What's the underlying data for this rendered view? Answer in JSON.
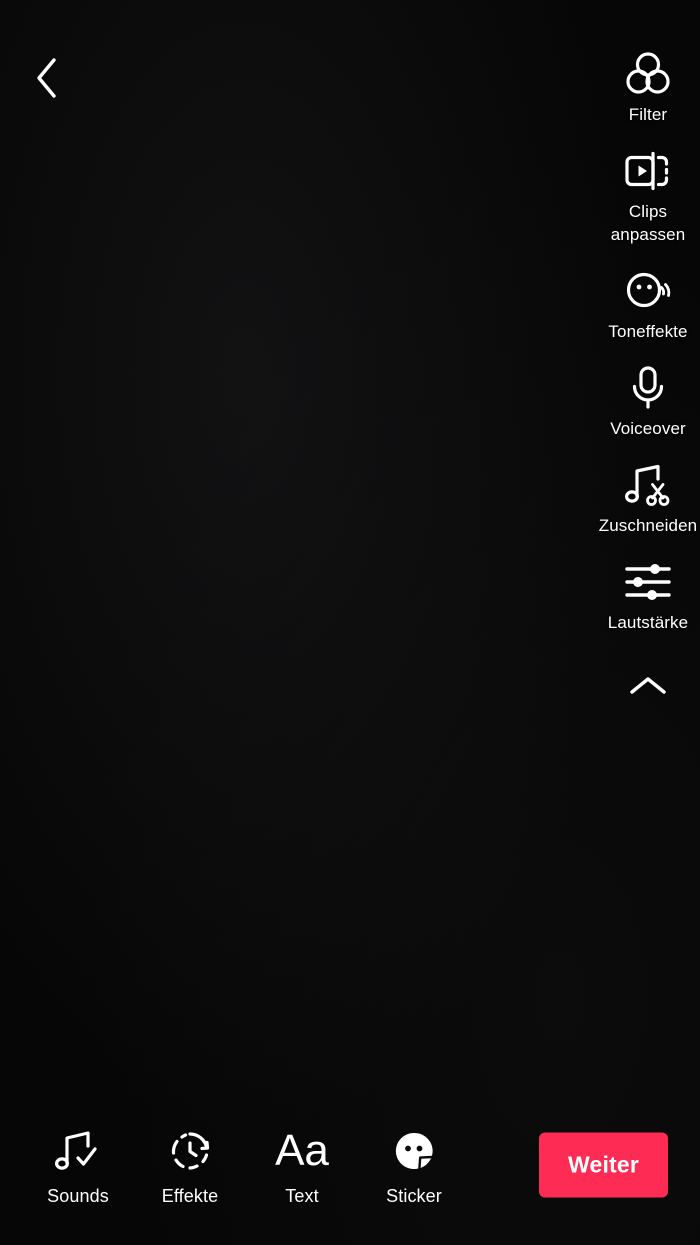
{
  "app": {
    "screen_name": "TikTok Video Editor",
    "background_color": "#000000",
    "accent_color": "#FE2C55"
  },
  "header": {
    "back_icon": "chevron-left-icon"
  },
  "tool_rail": {
    "collapse_icon": "chevron-up-icon",
    "items": [
      {
        "label": "Filter",
        "icon": "filter-circles-icon"
      },
      {
        "label": "Clips anpassen",
        "icon": "adjust-clips-icon"
      },
      {
        "label": "Toneffekte",
        "icon": "voice-effects-smiley-icon"
      },
      {
        "label": "Voiceover",
        "icon": "microphone-icon"
      },
      {
        "label": "Zuschneiden",
        "icon": "music-scissors-icon"
      },
      {
        "label": "Lautstärke",
        "icon": "sliders-icon"
      }
    ]
  },
  "bottom_bar": {
    "items": [
      {
        "label": "Sounds",
        "icon": "music-note-check-icon"
      },
      {
        "label": "Effekte",
        "icon": "clock-refresh-icon"
      },
      {
        "label": "Text",
        "icon": "text-aa-icon"
      },
      {
        "label": "Sticker",
        "icon": "sticker-face-icon"
      }
    ],
    "next_button": {
      "label": "Weiter",
      "color": "#FE2C55"
    }
  }
}
